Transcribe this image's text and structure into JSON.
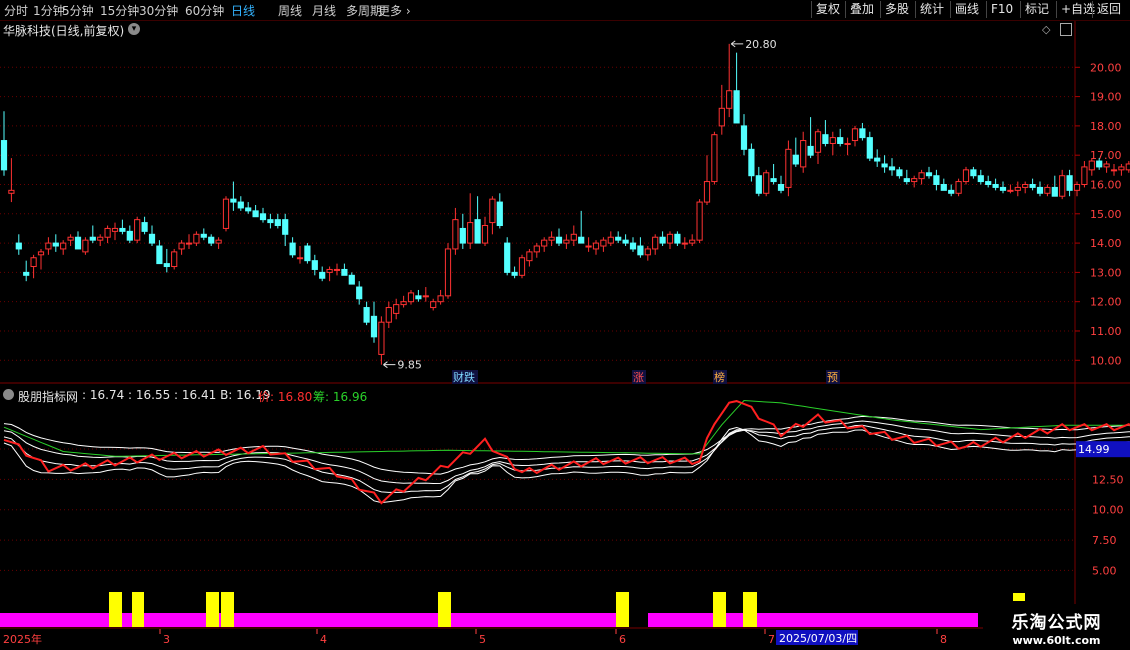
{
  "toolbar": {
    "periods": [
      "分时",
      "1分钟",
      "5分钟",
      "15分钟",
      "30分钟",
      "60分钟",
      "日线",
      "周线",
      "月线",
      "多周期",
      "更多"
    ],
    "active_period": "日线",
    "right_buttons": [
      "复权",
      "叠加",
      "多股",
      "统计",
      "画线",
      "F10",
      "+自选",
      "返回"
    ],
    "mark_label": "标记"
  },
  "stock_title": "华脉科技(日线,前复权)",
  "indicator": {
    "name": "股朋指标网",
    "values_text": ": 16.74 : 16.55 : 16.41  B: 16.19",
    "price_label": "价: 16.80",
    "chip_label": "筹: 16.96",
    "current_value": "14.99"
  },
  "events": [
    "财跌",
    "涨",
    "榜",
    "预"
  ],
  "date_axis": {
    "year_label": "2025年",
    "months": [
      "3",
      "4",
      "5",
      "6",
      "7",
      "8"
    ],
    "cursor_date": "2025/07/03/四"
  },
  "brand": {
    "name": "乐淘公式网",
    "url": "www.60lt.com"
  },
  "colors": {
    "up": "#ff3232",
    "down": "#54ffff",
    "green_line": "#2ad02a",
    "red_line": "#ff2020",
    "yellow": "#ffff00",
    "magenta": "#ff00ff",
    "bg": "#000000"
  },
  "chart_data": [
    {
      "type": "candlestick",
      "title": "华脉科技(日线,前复权)",
      "yticks": [
        10.0,
        11.0,
        12.0,
        13.0,
        14.0,
        15.0,
        16.0,
        17.0,
        18.0,
        19.0,
        20.0
      ],
      "ylim": [
        9.6,
        21.0
      ],
      "annotations": [
        {
          "label": "20.80",
          "value": 20.8
        },
        {
          "label": "9.85",
          "value": 9.85
        }
      ],
      "ohlc": [
        [
          17.5,
          18.5,
          16.3,
          16.5
        ],
        [
          15.7,
          16.9,
          15.4,
          15.8
        ],
        [
          14.0,
          14.3,
          13.6,
          13.8
        ],
        [
          13.0,
          13.4,
          12.7,
          12.9
        ],
        [
          13.2,
          13.6,
          12.8,
          13.5
        ],
        [
          13.6,
          13.8,
          13.1,
          13.7
        ],
        [
          13.8,
          14.2,
          13.6,
          14.0
        ],
        [
          14.0,
          14.3,
          13.7,
          13.9
        ],
        [
          13.8,
          14.1,
          13.6,
          14.0
        ],
        [
          14.1,
          14.3,
          13.9,
          14.2
        ],
        [
          14.2,
          14.4,
          13.8,
          13.8
        ],
        [
          13.7,
          14.2,
          13.6,
          14.1
        ],
        [
          14.2,
          14.6,
          14.0,
          14.1
        ],
        [
          14.1,
          14.3,
          13.9,
          14.2
        ],
        [
          14.2,
          14.6,
          14.0,
          14.5
        ],
        [
          14.4,
          14.7,
          14.1,
          14.5
        ],
        [
          14.5,
          14.8,
          14.3,
          14.4
        ],
        [
          14.4,
          14.6,
          14.0,
          14.1
        ],
        [
          14.1,
          14.9,
          14.0,
          14.8
        ],
        [
          14.7,
          14.9,
          14.3,
          14.4
        ],
        [
          14.3,
          14.6,
          13.9,
          14.0
        ],
        [
          13.9,
          14.1,
          13.3,
          13.3
        ],
        [
          13.3,
          13.8,
          13.0,
          13.2
        ],
        [
          13.2,
          13.8,
          13.1,
          13.7
        ],
        [
          13.8,
          14.1,
          13.6,
          14.0
        ],
        [
          14.0,
          14.3,
          13.8,
          14.0
        ],
        [
          14.0,
          14.4,
          13.9,
          14.3
        ],
        [
          14.3,
          14.5,
          14.1,
          14.2
        ],
        [
          14.2,
          14.3,
          13.9,
          14.0
        ],
        [
          14.0,
          14.2,
          13.8,
          14.1
        ],
        [
          14.5,
          15.6,
          14.4,
          15.5
        ],
        [
          15.5,
          16.1,
          15.1,
          15.4
        ],
        [
          15.4,
          15.6,
          15.1,
          15.2
        ],
        [
          15.2,
          15.4,
          15.0,
          15.1
        ],
        [
          15.1,
          15.3,
          14.9,
          14.9
        ],
        [
          15.0,
          15.2,
          14.7,
          14.8
        ],
        [
          14.8,
          15.0,
          14.5,
          14.7
        ],
        [
          14.8,
          15.0,
          14.5,
          14.6
        ],
        [
          14.8,
          15.0,
          13.9,
          14.3
        ],
        [
          14.0,
          14.2,
          13.5,
          13.6
        ],
        [
          13.5,
          13.9,
          13.3,
          13.5
        ],
        [
          13.9,
          14.0,
          13.3,
          13.4
        ],
        [
          13.4,
          13.6,
          12.9,
          13.1
        ],
        [
          13.0,
          13.2,
          12.7,
          12.8
        ],
        [
          13.0,
          13.2,
          12.7,
          13.1
        ],
        [
          13.1,
          13.3,
          12.9,
          13.1
        ],
        [
          13.1,
          13.3,
          12.9,
          12.9
        ],
        [
          12.9,
          13.0,
          12.6,
          12.6
        ],
        [
          12.5,
          12.7,
          11.9,
          12.1
        ],
        [
          11.8,
          12.0,
          11.2,
          11.3
        ],
        [
          11.5,
          12.0,
          10.6,
          10.8
        ],
        [
          10.2,
          11.5,
          9.85,
          11.3
        ],
        [
          11.3,
          12.0,
          11.1,
          11.8
        ],
        [
          11.6,
          12.1,
          11.4,
          11.9
        ],
        [
          11.9,
          12.2,
          11.8,
          12.0
        ],
        [
          12.0,
          12.4,
          11.9,
          12.3
        ],
        [
          12.2,
          12.4,
          12.0,
          12.1
        ],
        [
          12.2,
          12.5,
          12.0,
          12.2
        ],
        [
          11.8,
          12.1,
          11.7,
          12.0
        ],
        [
          12.0,
          12.4,
          11.9,
          12.2
        ],
        [
          12.2,
          14.0,
          12.1,
          13.8
        ],
        [
          13.8,
          15.2,
          13.6,
          14.8
        ],
        [
          14.5,
          15.0,
          13.8,
          14.0
        ],
        [
          14.0,
          15.7,
          13.8,
          14.7
        ],
        [
          14.8,
          15.6,
          14.0,
          14.0
        ],
        [
          14.0,
          14.9,
          13.9,
          14.6
        ],
        [
          14.7,
          15.6,
          14.3,
          15.5
        ],
        [
          15.4,
          15.7,
          14.5,
          14.6
        ],
        [
          14.0,
          14.2,
          12.9,
          13.0
        ],
        [
          13.0,
          13.2,
          12.8,
          12.9
        ],
        [
          12.9,
          13.6,
          12.8,
          13.5
        ],
        [
          13.4,
          13.8,
          13.2,
          13.7
        ],
        [
          13.7,
          14.0,
          13.5,
          13.9
        ],
        [
          13.9,
          14.2,
          13.7,
          14.1
        ],
        [
          14.1,
          14.4,
          13.9,
          14.2
        ],
        [
          14.2,
          14.5,
          13.9,
          14.0
        ],
        [
          14.0,
          14.3,
          13.8,
          14.1
        ],
        [
          14.1,
          14.6,
          13.9,
          14.3
        ],
        [
          14.2,
          15.1,
          14.0,
          14.0
        ],
        [
          13.9,
          14.2,
          13.7,
          13.9
        ],
        [
          13.8,
          14.1,
          13.6,
          14.0
        ],
        [
          13.9,
          14.2,
          13.7,
          14.1
        ],
        [
          14.0,
          14.4,
          13.9,
          14.2
        ],
        [
          14.2,
          14.4,
          14.0,
          14.1
        ],
        [
          14.1,
          14.3,
          13.9,
          14.0
        ],
        [
          14.0,
          14.2,
          13.7,
          13.8
        ],
        [
          13.9,
          14.2,
          13.5,
          13.6
        ],
        [
          13.6,
          13.9,
          13.4,
          13.8
        ],
        [
          13.8,
          14.3,
          13.6,
          14.2
        ],
        [
          14.2,
          14.4,
          13.9,
          14.0
        ],
        [
          14.0,
          14.4,
          13.8,
          14.3
        ],
        [
          14.3,
          14.4,
          13.9,
          14.0
        ],
        [
          14.0,
          14.2,
          13.8,
          14.0
        ],
        [
          14.0,
          14.3,
          13.9,
          14.1
        ],
        [
          14.1,
          15.5,
          14.0,
          15.4
        ],
        [
          15.4,
          17.0,
          15.3,
          16.1
        ],
        [
          16.1,
          17.8,
          16.0,
          17.7
        ],
        [
          18.0,
          19.4,
          17.7,
          18.6
        ],
        [
          18.6,
          20.8,
          18.3,
          19.2
        ],
        [
          19.2,
          20.5,
          18.1,
          18.1
        ],
        [
          18.0,
          18.4,
          17.0,
          17.2
        ],
        [
          17.2,
          17.4,
          16.1,
          16.3
        ],
        [
          16.3,
          16.6,
          15.6,
          15.7
        ],
        [
          15.7,
          16.5,
          15.6,
          16.4
        ],
        [
          16.2,
          16.7,
          16.0,
          16.1
        ],
        [
          16.0,
          16.3,
          15.7,
          15.8
        ],
        [
          15.9,
          17.5,
          15.6,
          17.2
        ],
        [
          17.0,
          17.6,
          16.6,
          16.7
        ],
        [
          16.6,
          17.8,
          16.4,
          17.5
        ],
        [
          17.3,
          18.3,
          16.9,
          17.0
        ],
        [
          17.1,
          17.9,
          16.7,
          17.8
        ],
        [
          17.7,
          18.2,
          17.3,
          17.4
        ],
        [
          17.4,
          17.8,
          17.0,
          17.6
        ],
        [
          17.6,
          17.9,
          17.3,
          17.4
        ],
        [
          17.4,
          17.6,
          17.0,
          17.4
        ],
        [
          17.5,
          18.0,
          17.3,
          17.9
        ],
        [
          17.9,
          18.1,
          17.5,
          17.6
        ],
        [
          17.6,
          17.8,
          16.8,
          16.9
        ],
        [
          16.9,
          17.2,
          16.6,
          16.8
        ],
        [
          16.7,
          17.0,
          16.4,
          16.6
        ],
        [
          16.6,
          16.9,
          16.3,
          16.5
        ],
        [
          16.5,
          16.6,
          16.2,
          16.3
        ],
        [
          16.2,
          16.5,
          16.0,
          16.1
        ],
        [
          16.1,
          16.3,
          15.9,
          16.2
        ],
        [
          16.2,
          16.5,
          16.0,
          16.4
        ],
        [
          16.4,
          16.6,
          16.2,
          16.3
        ],
        [
          16.3,
          16.5,
          15.8,
          16.0
        ],
        [
          16.0,
          16.2,
          15.8,
          15.8
        ],
        [
          15.8,
          16.0,
          15.6,
          15.7
        ],
        [
          15.7,
          16.2,
          15.6,
          16.1
        ],
        [
          16.1,
          16.6,
          16.0,
          16.5
        ],
        [
          16.5,
          16.6,
          16.2,
          16.3
        ],
        [
          16.3,
          16.5,
          16.0,
          16.1
        ],
        [
          16.1,
          16.3,
          15.9,
          16.0
        ],
        [
          16.0,
          16.2,
          15.8,
          15.9
        ],
        [
          15.9,
          16.1,
          15.7,
          15.8
        ],
        [
          15.8,
          16.0,
          15.7,
          15.8
        ],
        [
          15.8,
          16.1,
          15.6,
          15.9
        ],
        [
          15.9,
          16.1,
          15.7,
          16.0
        ],
        [
          16.0,
          16.2,
          15.8,
          15.9
        ],
        [
          15.9,
          16.1,
          15.6,
          15.7
        ],
        [
          15.7,
          16.0,
          15.6,
          15.9
        ],
        [
          15.9,
          16.3,
          15.8,
          15.6
        ],
        [
          15.6,
          16.5,
          15.5,
          16.3
        ],
        [
          16.3,
          16.5,
          15.6,
          15.8
        ],
        [
          15.8,
          16.1,
          15.6,
          16.0
        ],
        [
          16.0,
          16.8,
          15.9,
          16.6
        ],
        [
          16.5,
          16.9,
          16.3,
          16.8
        ],
        [
          16.8,
          16.9,
          16.5,
          16.6
        ],
        [
          16.6,
          16.8,
          16.4,
          16.7
        ],
        [
          16.5,
          16.7,
          16.3,
          16.5
        ],
        [
          16.5,
          16.7,
          16.3,
          16.6
        ],
        [
          16.5,
          16.8,
          16.4,
          16.7
        ],
        [
          16.6,
          16.9,
          16.4,
          16.5
        ],
        [
          16.6,
          17.3,
          16.5,
          16.9
        ],
        [
          16.5,
          16.9,
          16.3,
          16.4
        ],
        [
          16.0,
          16.6,
          15.9,
          16.5
        ],
        [
          16.5,
          16.9,
          16.4,
          16.8
        ],
        [
          16.7,
          17.5,
          16.6,
          17.1
        ],
        [
          17.1,
          17.3,
          16.8,
          17.0
        ],
        [
          17.0,
          17.2,
          16.8,
          17.1
        ],
        [
          17.1,
          17.2,
          16.8,
          16.9
        ],
        [
          16.9,
          17.1,
          16.7,
          16.8
        ]
      ]
    },
    {
      "type": "line",
      "title": "股朋指标网",
      "yticks": [
        5.0,
        7.5,
        10.0,
        12.5,
        15.0
      ],
      "ylim": [
        3.8,
        19.7
      ],
      "series": [
        {
          "name": "价",
          "x": [
            0,
            6,
            10,
            20,
            35,
            45,
            51,
            58,
            65,
            70,
            80,
            88,
            94,
            96,
            99,
            105,
            110,
            120,
            130,
            140,
            143
          ],
          "values": [
            16.0,
            13.4,
            13.5,
            14.3,
            15.0,
            13.0,
            10.8,
            13.0,
            15.6,
            13.1,
            14.0,
            14.1,
            14.0,
            17.3,
            19.2,
            16.3,
            17.6,
            16.0,
            15.2,
            16.4,
            16.8
          ]
        },
        {
          "name": "筹",
          "x": [
            0,
            8,
            15,
            60,
            94,
            97,
            100,
            105,
            120,
            132,
            143
          ],
          "values": [
            16.8,
            14.8,
            14.4,
            14.9,
            14.6,
            17.0,
            19.0,
            18.8,
            17.4,
            16.6,
            16.96
          ]
        }
      ]
    }
  ]
}
